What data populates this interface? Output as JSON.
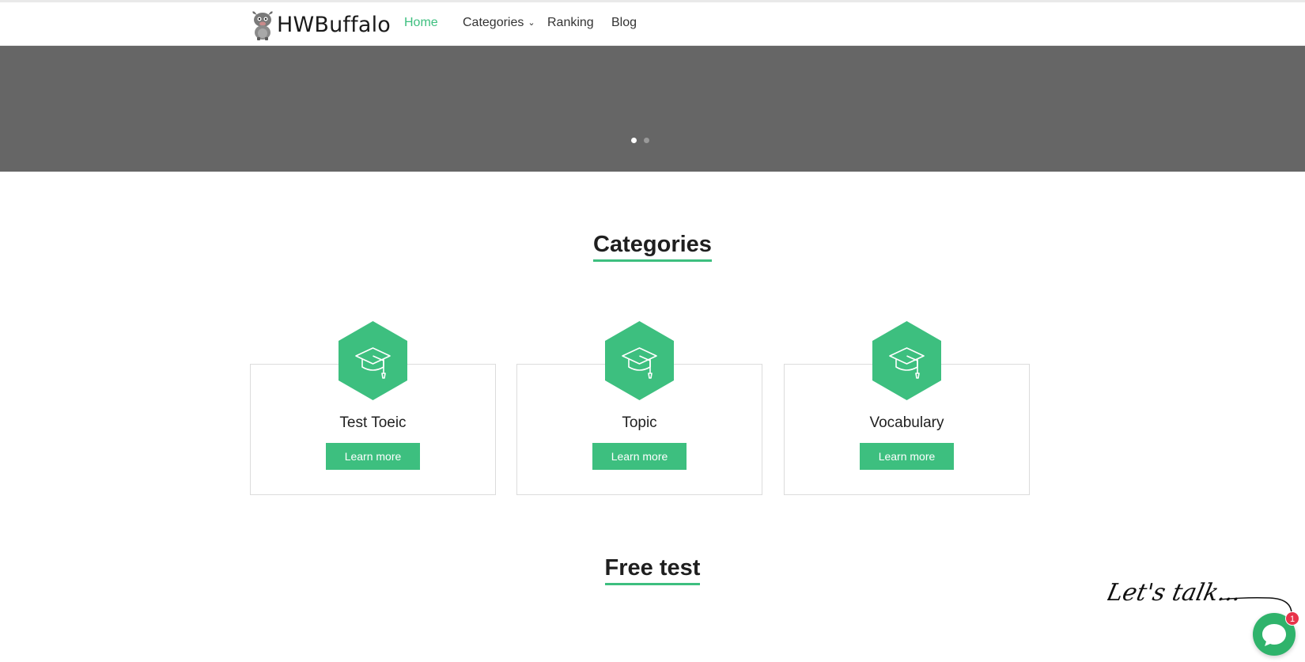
{
  "brand": {
    "name": "HWBuffalo"
  },
  "nav": {
    "items": [
      {
        "label": "Home",
        "active": true
      },
      {
        "label": "Categories",
        "dropdown": true
      },
      {
        "label": "Ranking"
      },
      {
        "label": "Blog"
      }
    ]
  },
  "hero": {
    "slide_count": 2,
    "active_slide": 1
  },
  "sections": {
    "categories_title": "Categories",
    "free_test_title": "Free test"
  },
  "categories": [
    {
      "title": "Test Toeic",
      "button": "Learn more",
      "icon": "graduation-cap-icon"
    },
    {
      "title": "Topic",
      "button": "Learn more",
      "icon": "graduation-cap-icon"
    },
    {
      "title": "Vocabulary",
      "button": "Learn more",
      "icon": "graduation-cap-icon"
    }
  ],
  "chat": {
    "tagline": "Let's talk...",
    "badge_count": "1",
    "icon": "chat-bubble-icon"
  },
  "colors": {
    "accent": "#3dbf7f",
    "hero_bg": "#666666",
    "chat_green": "#2fb36b",
    "badge_red": "#e8334a"
  }
}
